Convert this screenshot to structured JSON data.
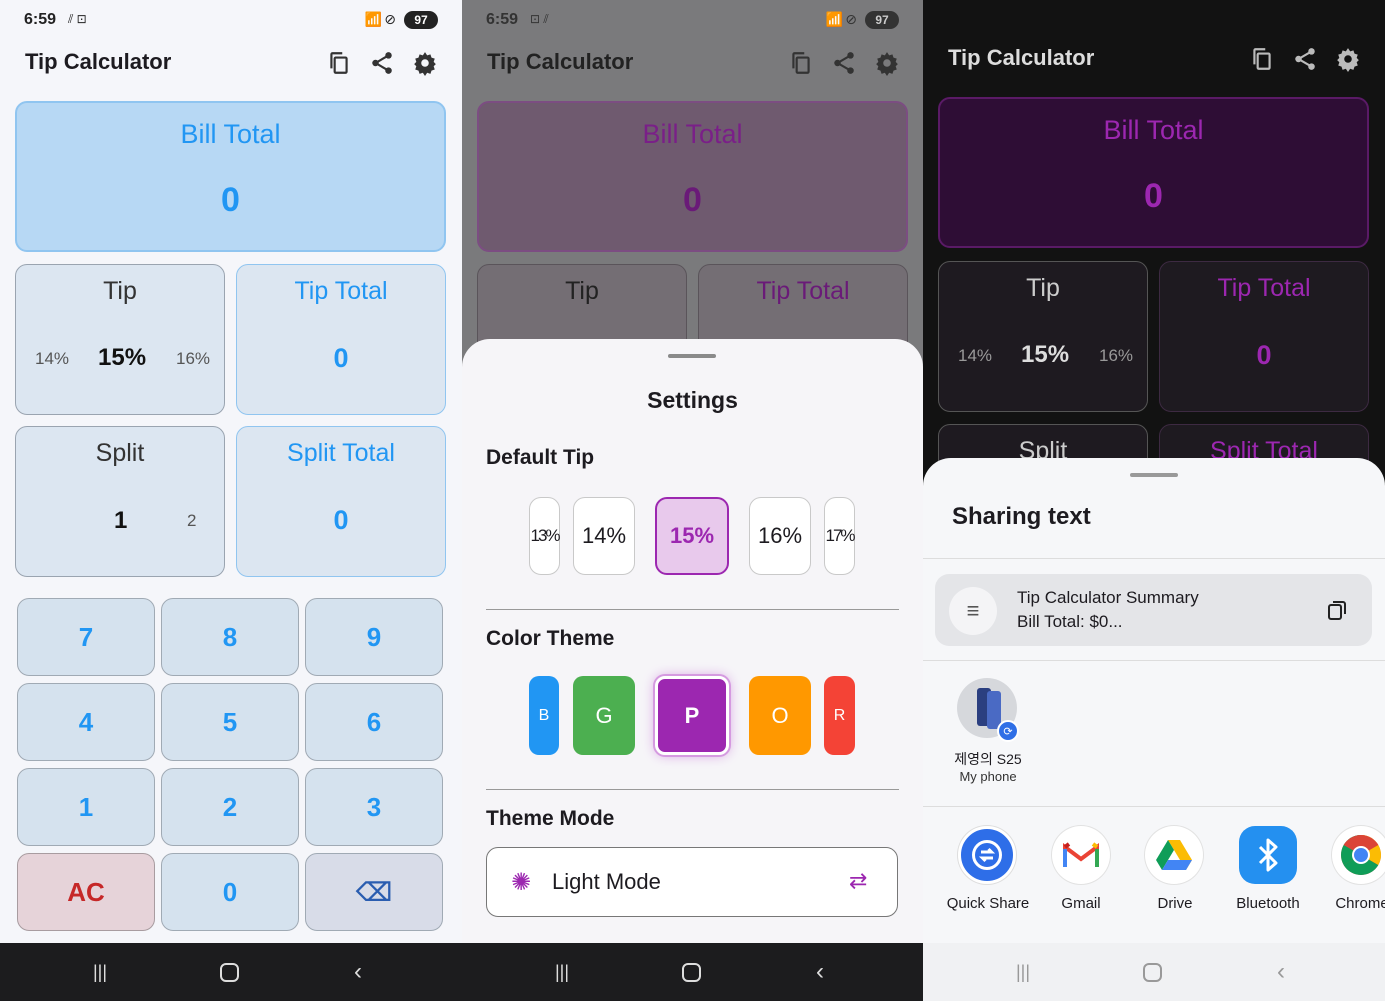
{
  "status": {
    "time": "6:59",
    "battery": "97"
  },
  "app": {
    "title": "Tip Calculator"
  },
  "bill": {
    "label": "Bill Total",
    "value": "0"
  },
  "tip": {
    "label": "Tip",
    "prev": "14%",
    "current": "15%",
    "next": "16%"
  },
  "tip_total": {
    "label": "Tip Total",
    "value": "0"
  },
  "split": {
    "label": "Split",
    "current": "1",
    "next": "2"
  },
  "split_total": {
    "label": "Split Total",
    "value": "0"
  },
  "keypad": {
    "keys": [
      "7",
      "8",
      "9",
      "4",
      "5",
      "6",
      "1",
      "2",
      "3",
      "AC",
      "0",
      "⌫"
    ]
  },
  "settings": {
    "title": "Settings",
    "default_tip_label": "Default Tip",
    "tip_options": [
      "13%",
      "14%",
      "15%",
      "16%",
      "17%"
    ],
    "selected_tip": "15%",
    "color_theme_label": "Color Theme",
    "colors": [
      {
        "letter": "B",
        "color": "#2196f3"
      },
      {
        "letter": "G",
        "color": "#4caf50"
      },
      {
        "letter": "P",
        "color": "#9c27b0"
      },
      {
        "letter": "O",
        "color": "#ff9800"
      },
      {
        "letter": "R",
        "color": "#f44336"
      }
    ],
    "theme_mode_label": "Theme Mode",
    "theme_mode_value": "Light Mode"
  },
  "share": {
    "title": "Sharing text",
    "preview_title": "Tip Calculator Summary",
    "preview_text": "Bill Total: $0...",
    "device_name": "제영의 S25",
    "device_sub": "My phone",
    "apps": [
      "Quick Share",
      "Gmail",
      "Drive",
      "Bluetooth",
      "Chrome"
    ]
  },
  "colors": {
    "light_accent": "#2196f3",
    "light_card": "#dce6f1",
    "purple_accent": "#9c27b0"
  }
}
